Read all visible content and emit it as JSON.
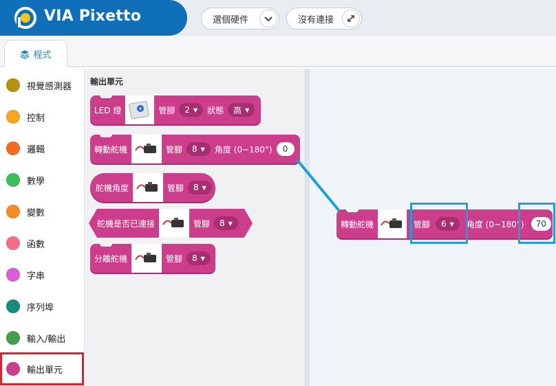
{
  "header": {
    "logo_text": "VIA Pixetto",
    "select_hardware": "選個硬件",
    "connection": "沒有連接",
    "brand_color": "#0f6fb8"
  },
  "tabs": [
    {
      "label": "程式",
      "icon": "layers-icon",
      "active": true
    }
  ],
  "categories": [
    {
      "label": "視覺感測器",
      "color": "#b59012"
    },
    {
      "label": "控制",
      "color": "#f5a623"
    },
    {
      "label": "邏輯",
      "color": "#f26b21"
    },
    {
      "label": "數學",
      "color": "#3dbf5a"
    },
    {
      "label": "變數",
      "color": "#f58a2a"
    },
    {
      "label": "函數",
      "color": "#f46d86"
    },
    {
      "label": "字串",
      "color": "#d85fd6"
    },
    {
      "label": "序列埠",
      "color": "#1a8a7c"
    },
    {
      "label": "輸入/輸出",
      "color": "#43a047"
    },
    {
      "label": "輸出單元",
      "color": "#cc3d8c",
      "selected": true
    }
  ],
  "flyout": {
    "title": "輸出單元",
    "blocks": {
      "led": {
        "label": "LED 燈",
        "pin_label": "管腳",
        "pin": "2",
        "state_label": "狀態",
        "state": "高"
      },
      "servo_rotate": {
        "label": "轉動舵機",
        "pin_label": "管腳",
        "pin": "8",
        "angle_label": "角度 (0~180°)",
        "angle": "0"
      },
      "servo_angle": {
        "label": "舵機角度",
        "pin_label": "管腳",
        "pin": "8"
      },
      "servo_connected": {
        "label": "舵機是否已連接",
        "pin_label": "管腳",
        "pin": "8"
      },
      "servo_detach": {
        "label": "分離舵機",
        "pin_label": "管腳",
        "pin": "8"
      }
    }
  },
  "workspace": {
    "block": {
      "label": "轉動舵機",
      "pin_label": "管腳",
      "pin": "6",
      "angle_label": "角度 (0~180°)",
      "angle": "70"
    },
    "highlight_color": "#1f9fd6"
  },
  "block_color": "#cc3d8c",
  "selection_outline_color": "#d9232d"
}
